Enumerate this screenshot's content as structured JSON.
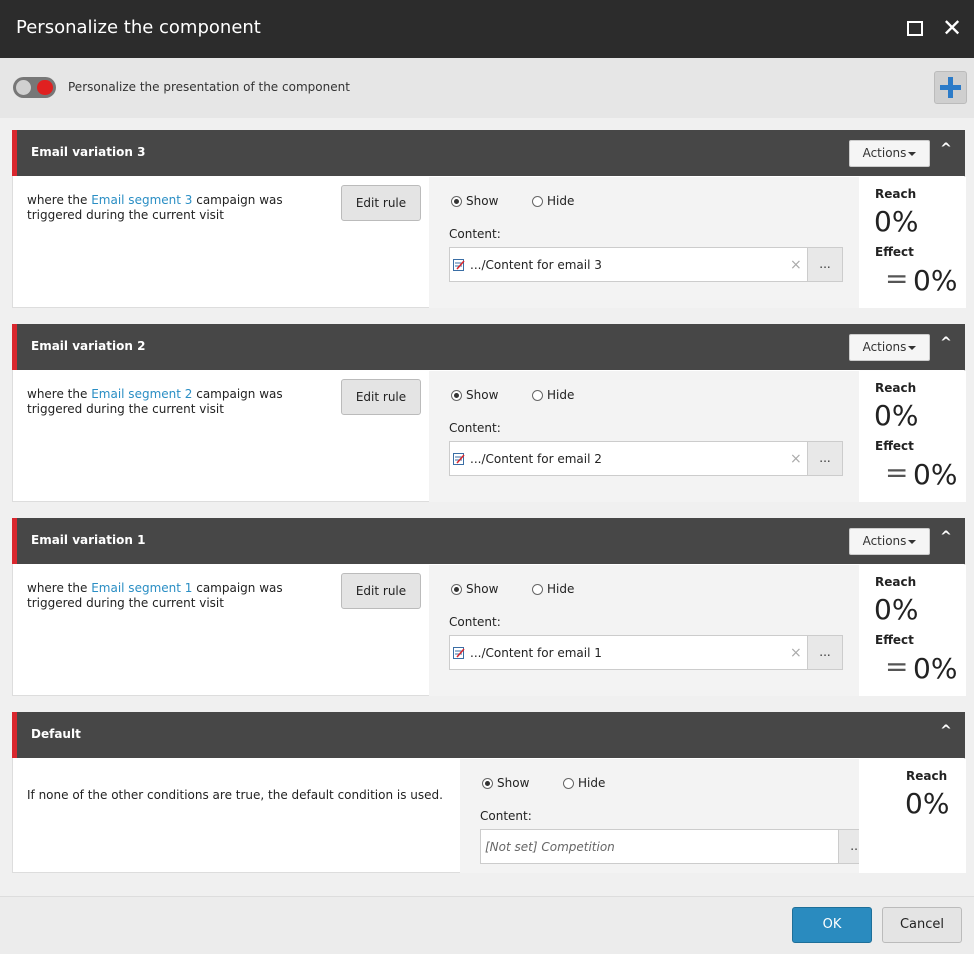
{
  "dialog": {
    "title": "Personalize the component"
  },
  "toolbar": {
    "toggle_label": "Personalize the presentation of the component"
  },
  "common": {
    "actions_label": "Actions",
    "edit_rule_label": "Edit rule",
    "show_label": "Show",
    "hide_label": "Hide",
    "content_label": "Content:",
    "reach_label": "Reach",
    "effect_label": "Effect",
    "effect_sign": "=",
    "browse_label": "...",
    "clear_label": "×",
    "cond_prefix": "where the",
    "cond_suffix": "campaign was triggered during the current visit"
  },
  "rules": [
    {
      "name": "Email variation 3",
      "segment": "Email segment 3",
      "selected": "show",
      "content": ".../Content for email 3",
      "reach": "0%",
      "effect": "0%"
    },
    {
      "name": "Email variation 2",
      "segment": "Email segment 2",
      "selected": "show",
      "content": ".../Content for email 2",
      "reach": "0%",
      "effect": "0%"
    },
    {
      "name": "Email variation 1",
      "segment": "Email segment 1",
      "selected": "show",
      "content": ".../Content for email 1",
      "reach": "0%",
      "effect": "0%"
    }
  ],
  "default_rule": {
    "name": "Default",
    "description": "If none of the other conditions are true, the default condition is used.",
    "selected": "show",
    "content_placeholder": "[Not set] Competition",
    "reach": "0%"
  },
  "footer": {
    "ok_label": "OK",
    "cancel_label": "Cancel"
  },
  "colors": {
    "accent_red": "#d9272e",
    "link_blue": "#2a8ec4",
    "primary_button": "#2a8bbf",
    "header_dark": "#474747"
  }
}
